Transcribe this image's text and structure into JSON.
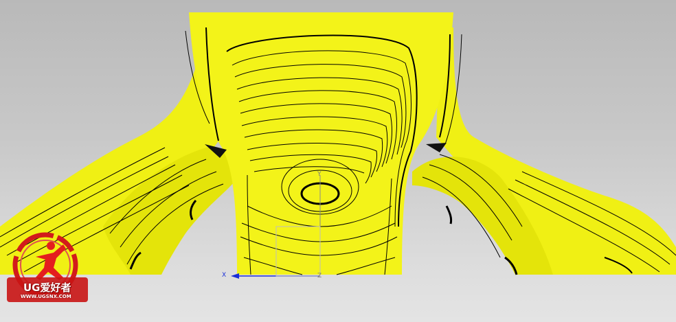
{
  "viewport": {
    "model_color": "#f0f014",
    "contour_color": "#000000",
    "background_top": "#b9b9b9",
    "background_bottom": "#e4e4e4"
  },
  "triad": {
    "x_label": "X",
    "y_label": "Y",
    "z_label": "Z",
    "x_color": "#1a2fd8",
    "z_color": "#8a8a8a"
  },
  "watermark": {
    "brand": "UG爱好者",
    "url": "WWW.UGSNX.COM",
    "ring_color": "#d21b1b",
    "icon": "running-figure-icon"
  }
}
